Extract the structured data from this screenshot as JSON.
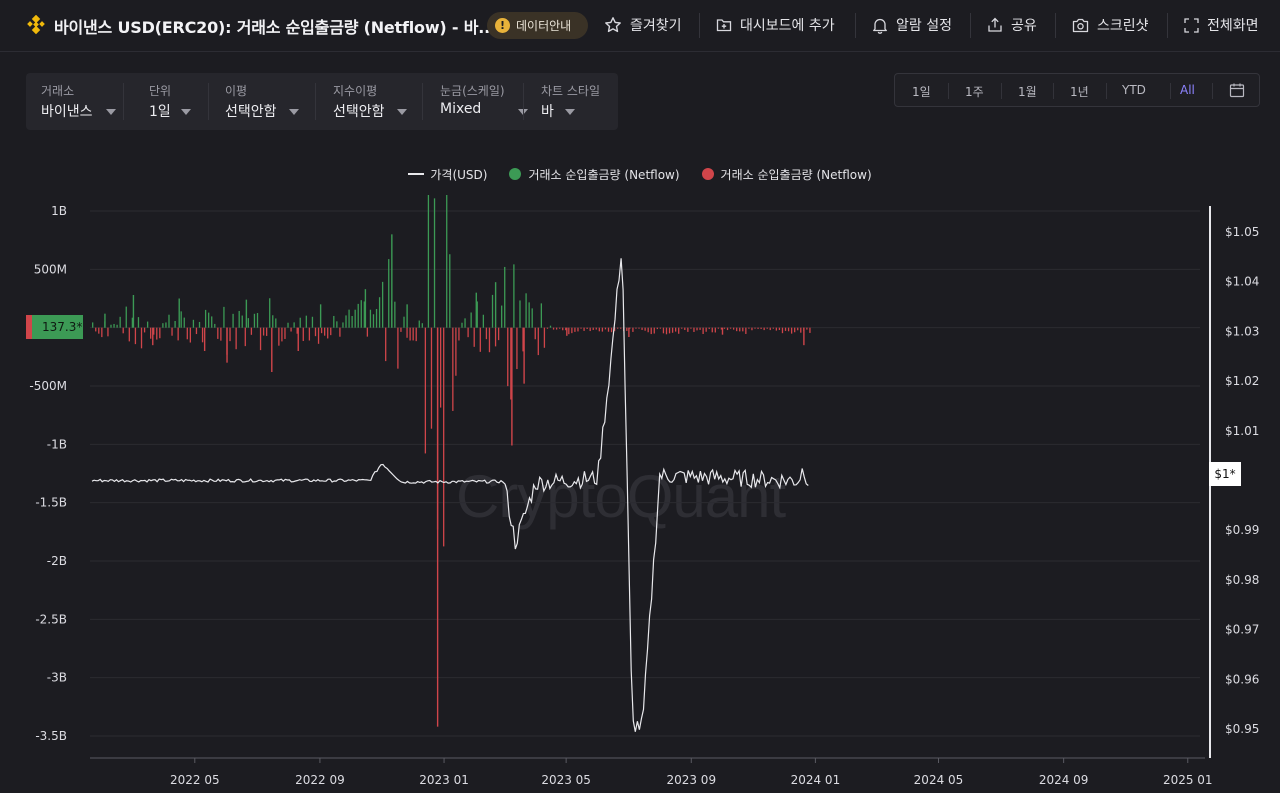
{
  "header": {
    "title": "바이낸스 USD(ERC20): 거래소 순입출금량 (Netflow) - 바...",
    "info_badge": "데이터안내",
    "actions": {
      "favorite": "즐겨찾기",
      "add_dashboard": "대시보드에 추가",
      "alert": "알람 설정",
      "share": "공유",
      "screenshot": "스크린샷",
      "fullscreen": "전체화면"
    }
  },
  "filters": [
    {
      "label": "거래소",
      "value": "바이낸스"
    },
    {
      "label": "단위",
      "value": "1일"
    },
    {
      "label": "이평",
      "value": "선택안함"
    },
    {
      "label": "지수이평",
      "value": "선택안함"
    },
    {
      "label": "눈금(스케일)",
      "value": "Mixed"
    },
    {
      "label": "차트 스타일",
      "value": "바"
    }
  ],
  "ranges": [
    "1일",
    "1주",
    "1월",
    "1년",
    "YTD",
    "All"
  ],
  "active_range": "All",
  "legend": {
    "price": "가격(USD)",
    "netflow_positive": "거래소 순입출금량 (Netflow)",
    "netflow_negative": "거래소 순입출금량 (Netflow)"
  },
  "watermark": "CryptoQuant",
  "markers": {
    "netflow_current": "137.3*",
    "price_current": "$1*"
  },
  "colors": {
    "positive": "#3c9a55",
    "negative": "#d0454a",
    "price_line": "#e8e8ec",
    "active_range": "#8d83ff"
  },
  "chart_data": {
    "type": "bar",
    "x_ticks": [
      "2022 05",
      "2022 09",
      "2023 01",
      "2023 05",
      "2023 09",
      "2024 01",
      "2024 05",
      "2024 09",
      "2025 01"
    ],
    "left_axis_ticks": [
      "1B",
      "500M",
      "",
      "-500M",
      "-1B",
      "-1.5B",
      "-2B",
      "-2.5B",
      "-3B",
      "-3.5B"
    ],
    "right_axis_ticks": [
      "$1.05",
      "$1.04",
      "$1.03",
      "$1.02",
      "$1.01",
      "",
      "$0.99",
      "$0.98",
      "$0.97",
      "$0.96",
      "$0.95"
    ],
    "left_range": [
      -3500000000.0,
      1000000000.0
    ],
    "right_range": [
      0.95,
      1.05
    ],
    "x_range": [
      "2022-01-18",
      "2025-01-15"
    ],
    "netflow_series": [
      {
        "date": "2022-02-01",
        "value": 120000000
      },
      {
        "date": "2022-03-01",
        "value": 280000000
      },
      {
        "date": "2022-03-20",
        "value": -150000000
      },
      {
        "date": "2022-04-15",
        "value": 250000000
      },
      {
        "date": "2022-05-10",
        "value": -200000000
      },
      {
        "date": "2022-06-01",
        "value": -300000000
      },
      {
        "date": "2022-06-20",
        "value": 240000000
      },
      {
        "date": "2022-07-15",
        "value": -380000000
      },
      {
        "date": "2022-08-10",
        "value": -200000000
      },
      {
        "date": "2022-09-01",
        "value": 200000000
      },
      {
        "date": "2022-10-15",
        "value": 330000000
      },
      {
        "date": "2022-11-10",
        "value": 800000000
      },
      {
        "date": "2022-11-25",
        "value": 200000000
      },
      {
        "date": "2022-12-25",
        "value": -3420000000
      },
      {
        "date": "2023-02-01",
        "value": 300000000
      },
      {
        "date": "2023-02-20",
        "value": 390000000
      },
      {
        "date": "2023-03-08",
        "value": -1010000000
      },
      {
        "date": "2023-03-20",
        "value": -480000000
      },
      {
        "date": "2023-05-01",
        "value": -70000000
      },
      {
        "date": "2023-07-01",
        "value": -80000000
      },
      {
        "date": "2023-10-01",
        "value": -60000000
      },
      {
        "date": "2023-12-20",
        "value": -150000000
      }
    ],
    "price_series": [
      {
        "date": "2022-01-20",
        "value": 1.0
      },
      {
        "date": "2022-10-20",
        "value": 1.0
      },
      {
        "date": "2022-11-01",
        "value": 1.0035
      },
      {
        "date": "2022-11-20",
        "value": 0.9997
      },
      {
        "date": "2023-03-01",
        "value": 0.9998
      },
      {
        "date": "2023-03-12",
        "value": 0.9875
      },
      {
        "date": "2023-04-01",
        "value": 0.9995
      },
      {
        "date": "2023-06-01",
        "value": 1.0005
      },
      {
        "date": "2023-06-15",
        "value": 1.026
      },
      {
        "date": "2023-06-25",
        "value": 1.048
      },
      {
        "date": "2023-07-05",
        "value": 0.951
      },
      {
        "date": "2023-07-15",
        "value": 0.9505
      },
      {
        "date": "2023-08-01",
        "value": 1.001
      },
      {
        "date": "2023-12-15",
        "value": 1.0
      },
      {
        "date": "2023-12-20",
        "value": 1.0025
      },
      {
        "date": "2023-12-25",
        "value": 1.0
      }
    ]
  }
}
